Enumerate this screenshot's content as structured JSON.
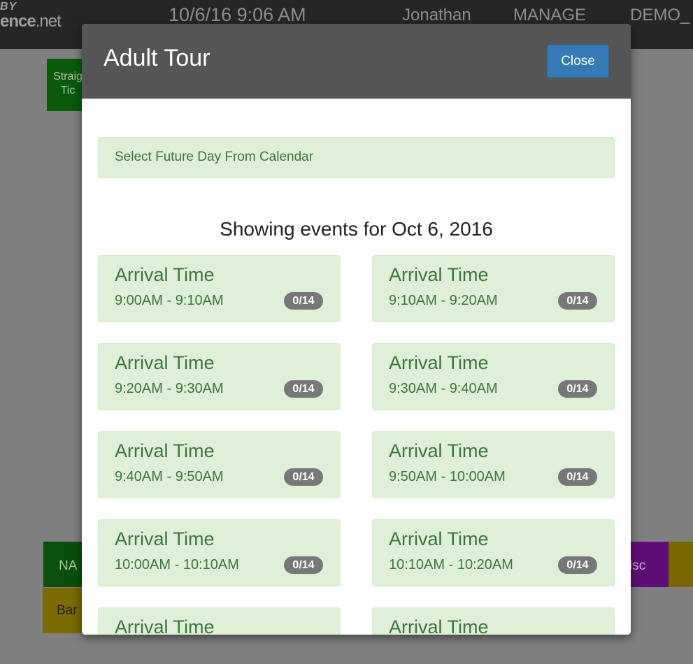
{
  "topbar": {
    "logo_by": "BY",
    "logo_name_bold": "ence",
    "logo_name_rest": ".net",
    "datetime": "10/6/16 9:06 AM",
    "user": "Jonathan",
    "manage": "MANAGE",
    "demo": "DEMO_"
  },
  "background_tiles": {
    "straight_line1": "Straig",
    "straight_line2": "Tic",
    "na": "NA",
    "bar": "Bar",
    "disc": "isc"
  },
  "colors": {
    "modal_header": "#555555",
    "close_button": "#337ab7",
    "success_bg": "#dff0d8",
    "success_text": "#3c763d",
    "badge": "#777777"
  },
  "modal": {
    "title": "Adult Tour",
    "close_label": "Close",
    "alert": "Select Future Day From Calendar",
    "heading": "Showing events for Oct 6, 2016",
    "events": [
      {
        "title": "Arrival Time",
        "time": "9:00AM - 9:10AM",
        "badge": "0/14"
      },
      {
        "title": "Arrival Time",
        "time": "9:10AM - 9:20AM",
        "badge": "0/14"
      },
      {
        "title": "Arrival Time",
        "time": "9:20AM - 9:30AM",
        "badge": "0/14"
      },
      {
        "title": "Arrival Time",
        "time": "9:30AM - 9:40AM",
        "badge": "0/14"
      },
      {
        "title": "Arrival Time",
        "time": "9:40AM - 9:50AM",
        "badge": "0/14"
      },
      {
        "title": "Arrival Time",
        "time": "9:50AM - 10:00AM",
        "badge": "0/14"
      },
      {
        "title": "Arrival Time",
        "time": "10:00AM - 10:10AM",
        "badge": "0/14"
      },
      {
        "title": "Arrival Time",
        "time": "10:10AM - 10:20AM",
        "badge": "0/14"
      },
      {
        "title": "Arrival Time"
      },
      {
        "title": "Arrival Time"
      }
    ]
  }
}
